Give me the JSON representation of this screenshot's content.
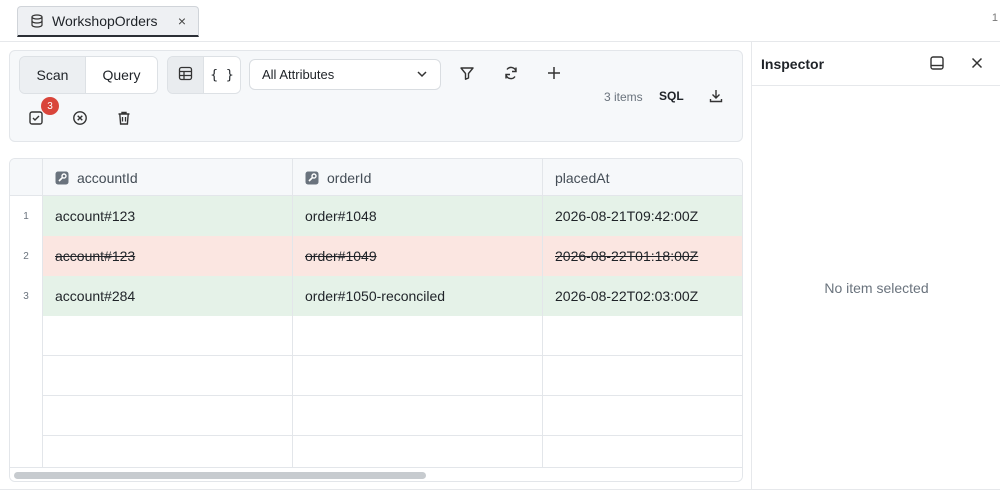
{
  "tab": {
    "title": "WorkshopOrders",
    "close": "×",
    "counter": "1"
  },
  "toolbar": {
    "modes": [
      "Scan",
      "Query"
    ],
    "attributes_select": "All Attributes",
    "items_count": "3 items",
    "sql_label": "SQL",
    "pending_badge": "3"
  },
  "table": {
    "columns": [
      {
        "label": "accountId",
        "key": true
      },
      {
        "label": "orderId",
        "key": true
      },
      {
        "label": "placedAt",
        "key": false
      }
    ],
    "rows": [
      {
        "num": "1",
        "state": "added",
        "cells": [
          "account#123",
          "order#1048",
          "2026-08-21T09:42:00Z"
        ]
      },
      {
        "num": "2",
        "state": "deleted",
        "cells": [
          "account#123",
          "order#1049",
          "2026-08-22T01:18:00Z"
        ]
      },
      {
        "num": "3",
        "state": "added",
        "cells": [
          "account#284",
          "order#1050-reconciled",
          "2026-08-22T02:03:00Z"
        ]
      }
    ]
  },
  "inspector": {
    "title": "Inspector",
    "empty_text": "No item selected"
  },
  "colors": {
    "added_row": "#e5f2e8",
    "deleted_row": "#fbe6e1",
    "badge": "#d9453b"
  }
}
